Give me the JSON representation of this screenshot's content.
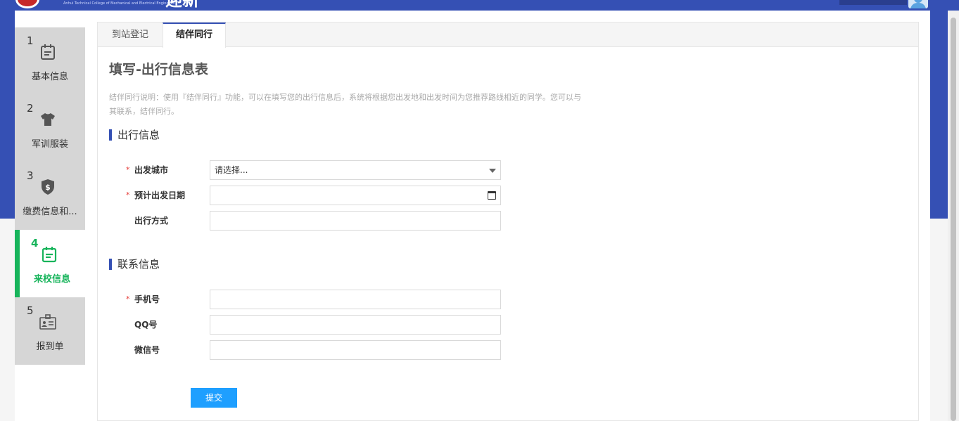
{
  "header": {
    "college_en": "Anhui Technical College of Mechanical and Electrical Engineering",
    "brand": "迎新"
  },
  "steps": [
    {
      "num": "1",
      "label": "基本信息",
      "icon": "calendar-icon"
    },
    {
      "num": "2",
      "label": "军训服装",
      "icon": "tshirt-icon"
    },
    {
      "num": "3",
      "label": "缴费信息和...",
      "icon": "dollar-shield-icon"
    },
    {
      "num": "4",
      "label": "来校信息",
      "icon": "calendar-check-icon",
      "active": true
    },
    {
      "num": "5",
      "label": "报到单",
      "icon": "id-card-icon"
    }
  ],
  "tabs": [
    {
      "label": "到站登记"
    },
    {
      "label": "结伴同行",
      "active": true
    }
  ],
  "form": {
    "title": "填写-出行信息表",
    "description": "结伴同行说明：使用『结伴同行』功能，可以在填写您的出行信息后，系统将根据您出发地和出发时间为您推荐路线相近的同学。您可以与其联系，结伴同行。",
    "required_mark": "*",
    "sections": {
      "travel": "出行信息",
      "contact": "联系信息"
    },
    "fields": {
      "city": {
        "label": "出发城市",
        "value": "请选择..."
      },
      "date": {
        "label": "预计出发日期",
        "value": ""
      },
      "mode": {
        "label": "出行方式",
        "value": ""
      },
      "phone": {
        "label": "手机号",
        "value": ""
      },
      "qq": {
        "label": "QQ号",
        "value": ""
      },
      "wechat": {
        "label": "微信号",
        "value": ""
      }
    },
    "submit_label": "提交"
  },
  "colors": {
    "header_blue": "#3550b4",
    "active_green": "#17b45b",
    "submit_blue": "#1e9fff",
    "required_red": "#e53935"
  }
}
